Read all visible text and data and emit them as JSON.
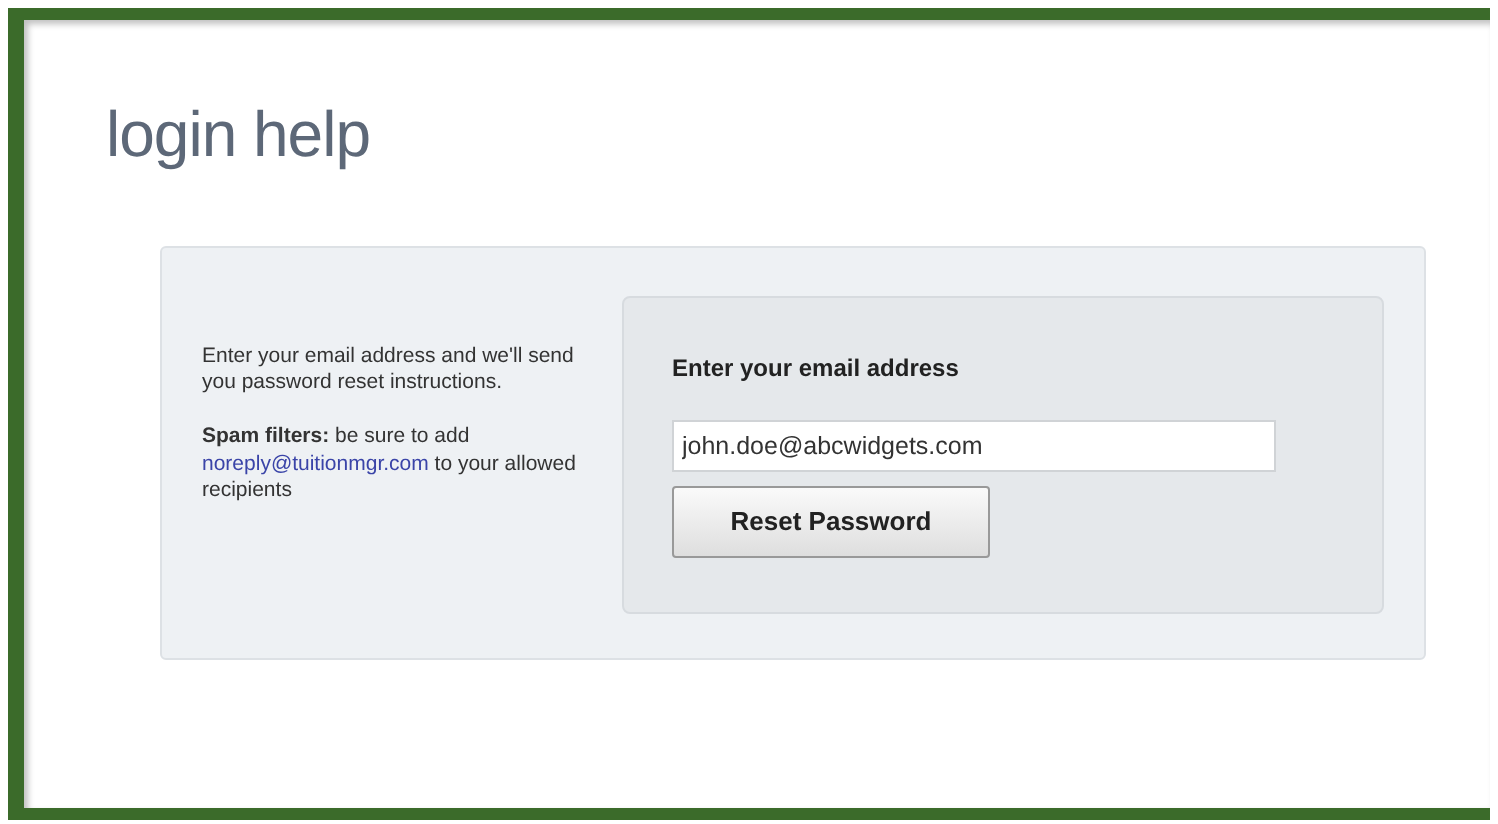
{
  "page_title": "login help",
  "intro": "Enter your email address and we'll send you password reset instructions.",
  "spam_note": {
    "lead": "**Spam filters:** be sure to add",
    "link": "noreply@tuitionmgr.com",
    "tail": "to your allowed recipients"
  },
  "form": {
    "label": "Enter your email address",
    "email_value": "john.doe@abcwidgets.com",
    "button": "Reset Password"
  }
}
